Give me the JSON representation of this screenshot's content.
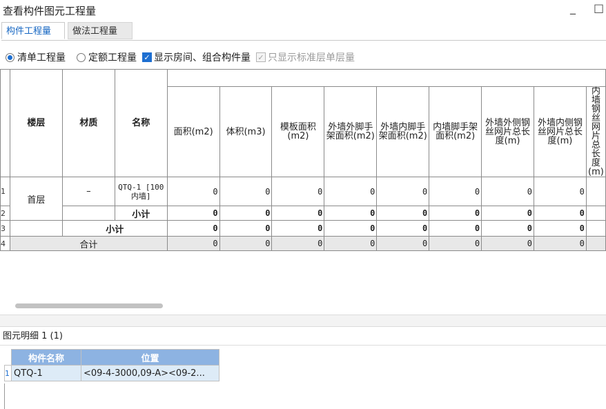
{
  "window": {
    "title": "查看构件图元工程量",
    "minimize": "_",
    "maximize": "□"
  },
  "tabs": [
    {
      "label": "构件工程量",
      "active": true
    },
    {
      "label": "做法工程量",
      "active": false
    }
  ],
  "options": {
    "radio_qingdan": "清单工程量",
    "radio_dinge": "定额工程量",
    "check_show_room": "显示房间、组合构件量",
    "check_only_std": "只显示标准层单层量"
  },
  "table": {
    "headers": {
      "floor": "楼层",
      "material": "材质",
      "name": "名称",
      "area": "面积(m2)",
      "volume": "体积(m3)",
      "formwork": "模板面积(m2)",
      "ext_outer_scaffold": "外墙外脚手架面积(m2)",
      "ext_inner_scaffold": "外墙内脚手架面积(m2)",
      "int_scaffold": "内墙脚手架面积(m2)",
      "ext_outer_mesh": "外墙外侧钢丝网片总长度(m)",
      "ext_inner_mesh": "外墙内侧钢丝网片总长度(m)",
      "int_mesh": "内墙钢丝网片总长度(m)"
    },
    "row_numbers": [
      "1",
      "2",
      "3",
      "4"
    ],
    "floor_value": "首层",
    "material_value": "–",
    "component_name": "QTQ-1 [100 内墙]",
    "subtotal_label": "小计",
    "floor_subtotal_label": "小计",
    "total_label": "合计",
    "row1_values": [
      "0",
      "0",
      "0",
      "0",
      "0",
      "0",
      "0",
      "0"
    ],
    "row2_values": [
      "0",
      "0",
      "0",
      "0",
      "0",
      "0",
      "0",
      "0"
    ],
    "row3_values": [
      "0",
      "0",
      "0",
      "0",
      "0",
      "0",
      "0",
      "0"
    ],
    "row4_values": [
      "0",
      "0",
      "0",
      "0",
      "0",
      "0",
      "0",
      "0"
    ]
  },
  "detail": {
    "title": "图元明细  1 (1)",
    "headers": {
      "name": "构件名称",
      "position": "位置"
    },
    "rows": [
      {
        "num": "1",
        "name": "QTQ-1",
        "position": "<09-4-3000,09-A><09-2..."
      }
    ]
  },
  "colors": {
    "accent": "#1e6fd1",
    "detail_header": "#8db3e2",
    "detail_row": "#ddebf7",
    "total_row": "#e8e8e8"
  }
}
